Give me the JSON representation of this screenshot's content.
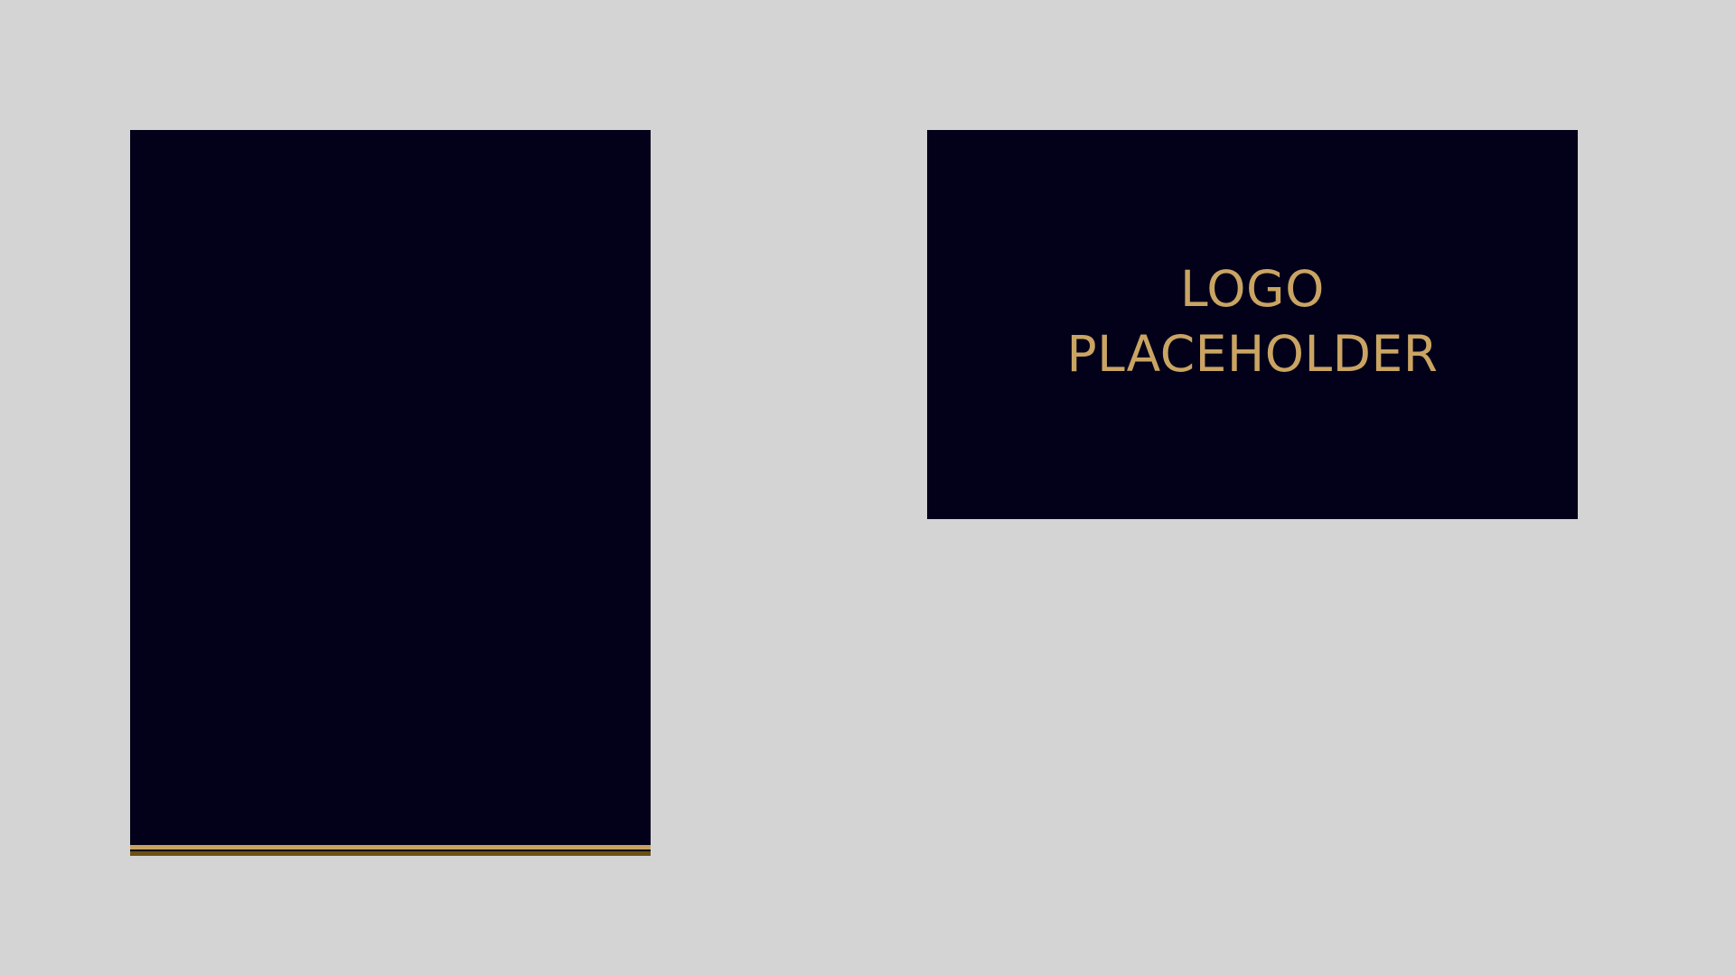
{
  "canvas": {
    "background_color": "#d4d4d4"
  },
  "left_panel": {
    "fill_color": "#03001a",
    "accent_colors": [
      "#c7a35f",
      "#6b5115"
    ]
  },
  "right_panel": {
    "fill_color": "#03001a",
    "text_color": "#c9a463",
    "logo_lines": [
      "LOGO",
      "PLACEHOLDER"
    ]
  }
}
